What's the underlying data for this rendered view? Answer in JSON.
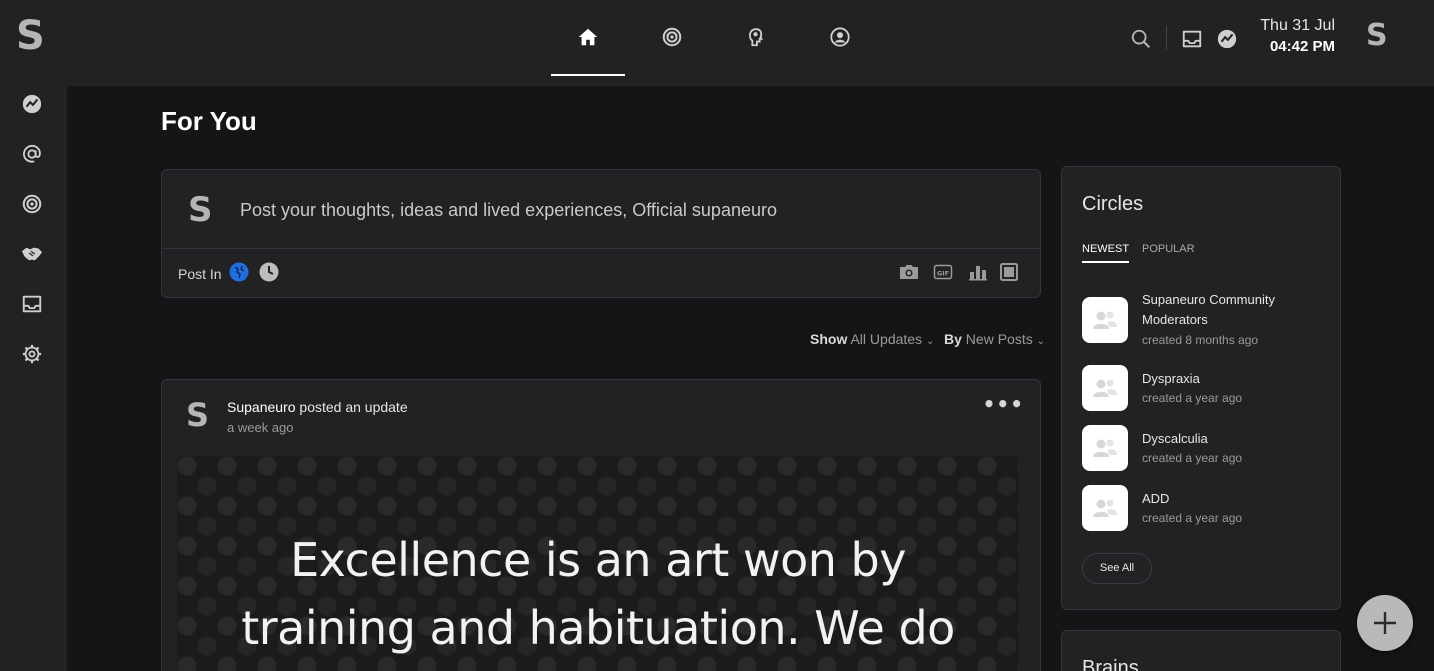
{
  "app": {
    "logo": "S",
    "user_initial": "S",
    "date": "Thu 31 Jul",
    "time": "04:42 PM"
  },
  "top_nav": [
    "home-icon",
    "target-icon",
    "head-brain-icon",
    "profile-icon"
  ],
  "top_right_icons": [
    "search-icon",
    "inbox-icon",
    "activity-icon"
  ],
  "sidebar": [
    "activity-icon",
    "at-icon",
    "target-icon",
    "handshake-icon",
    "inbox-icon",
    "gear-icon"
  ],
  "page": {
    "title": "For You"
  },
  "composer": {
    "avatar": "S",
    "placeholder": "Post your thoughts, ideas and lived experiences, Official supaneuro",
    "post_in_label": "Post In",
    "actions": [
      "photo-icon",
      "gif-icon",
      "poll-icon",
      "frame-icon"
    ]
  },
  "filters": {
    "show_label": "Show",
    "show_value": "All Updates",
    "by_label": "By",
    "by_value": "New Posts"
  },
  "post": {
    "avatar": "S",
    "author": "Supaneuro",
    "action": " posted an update",
    "time": "a week ago",
    "more": "•••",
    "quote_line1": "Excellence is an art won by",
    "quote_line2": "training and habituation. We do"
  },
  "circles": {
    "title": "Circles",
    "tabs": [
      "NEWEST",
      "POPULAR"
    ],
    "items": [
      {
        "name": "Supaneuro Community Moderators",
        "created": "created 8 months ago"
      },
      {
        "name": "Dyspraxia",
        "created": "created a year ago"
      },
      {
        "name": "Dyscalculia",
        "created": "created a year ago"
      },
      {
        "name": "ADD",
        "created": "created a year ago"
      }
    ],
    "see_all": "See All"
  },
  "brains": {
    "title": "Brains"
  },
  "colors": {
    "accent_blue": "#1e6fe0",
    "background": "#151517",
    "panel": "#222225"
  }
}
